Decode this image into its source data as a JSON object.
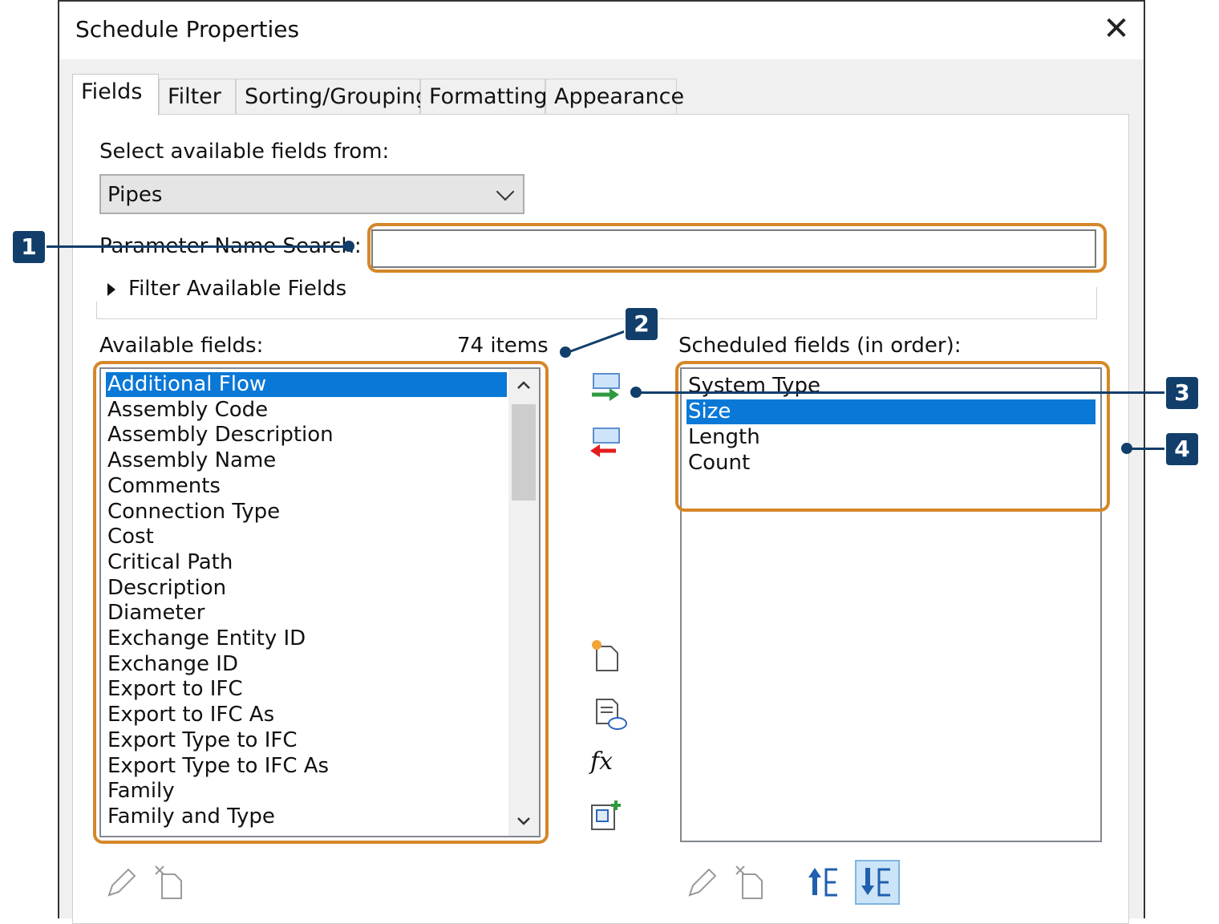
{
  "window": {
    "title": "Schedule Properties"
  },
  "tabs": [
    {
      "label": "Fields"
    },
    {
      "label": "Filter"
    },
    {
      "label": "Sorting/Grouping"
    },
    {
      "label": "Formatting"
    },
    {
      "label": "Appearance"
    }
  ],
  "fields_tab": {
    "select_label": "Select available fields from:",
    "category": "Pipes",
    "search_label": "Parameter Name Search:",
    "search_value": "",
    "filter_label": "Filter Available Fields",
    "available_label": "Available fields:",
    "item_count": "74 items",
    "scheduled_label": "Scheduled fields (in order):",
    "available_fields": [
      "Additional Flow",
      "Assembly Code",
      "Assembly Description",
      "Assembly Name",
      "Comments",
      "Connection Type",
      "Cost",
      "Critical Path",
      "Description",
      "Diameter",
      "Exchange Entity ID",
      "Exchange ID",
      "Export to IFC",
      "Export to IFC As",
      "Export Type to IFC",
      "Export Type to IFC As",
      "Family",
      "Family and Type"
    ],
    "available_selected": "Additional Flow",
    "scheduled_fields": [
      "System Type",
      "Size",
      "Length",
      "Count"
    ],
    "scheduled_selected": "Size"
  },
  "callouts": [
    "1",
    "2",
    "3",
    "4"
  ],
  "icons": {
    "add": "add-parameter-icon",
    "remove": "remove-parameter-icon",
    "new_param": "new-parameter-icon",
    "cloud": "cloud-parameter-icon",
    "formula": "formula-icon",
    "combine": "combine-parameters-icon",
    "edit": "pencil-icon",
    "delete": "delete-parameter-icon",
    "move_up": "move-up-icon",
    "move_down": "move-down-icon"
  },
  "colors": {
    "highlight": "#d58728",
    "callout": "#123e6b",
    "selection": "#0a78d7"
  }
}
